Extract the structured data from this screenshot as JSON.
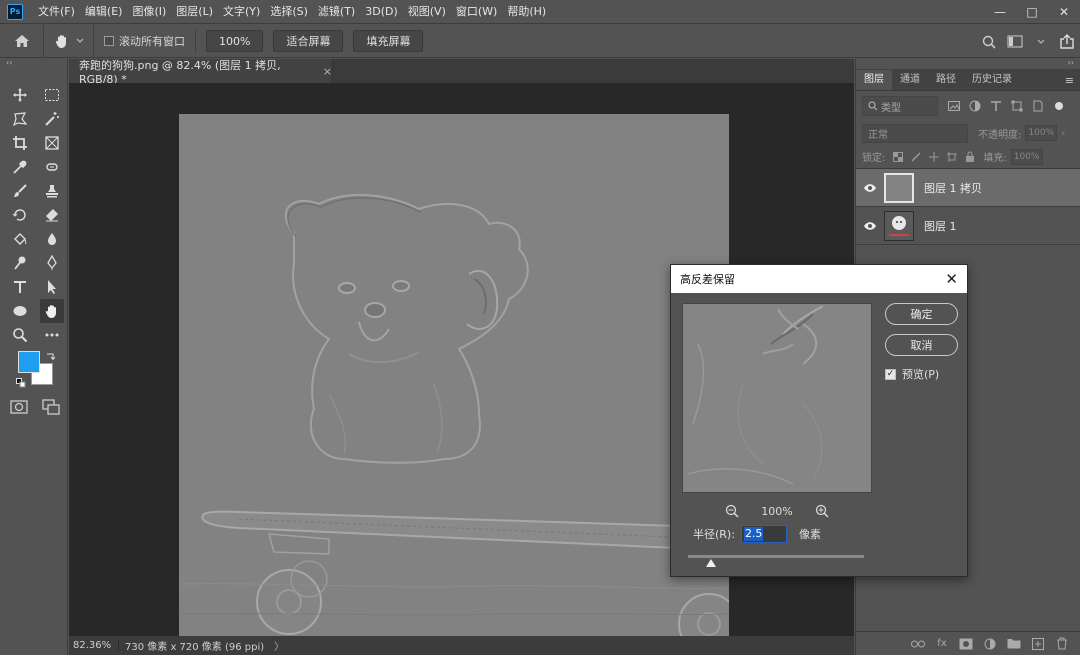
{
  "app": {
    "logo": "Ps"
  },
  "menubar": {
    "items": [
      "文件(F)",
      "编辑(E)",
      "图像(I)",
      "图层(L)",
      "文字(Y)",
      "选择(S)",
      "滤镜(T)",
      "3D(D)",
      "视图(V)",
      "窗口(W)",
      "帮助(H)"
    ],
    "window_controls": [
      "—",
      "□",
      "✕"
    ]
  },
  "options": {
    "scroll_all_label": "滚动所有窗口",
    "zoom_value": "100%",
    "fit_screen_label": "适合屏幕",
    "fill_screen_label": "填充屏幕"
  },
  "document": {
    "tab_title": "奔跑的狗狗.png @ 82.4% (图层 1 拷贝, RGB/8) *",
    "close_glyph": "×",
    "status_zoom": "82.36%",
    "status_info": "730 像素 x 720 像素 (96 ppi)",
    "status_arrow": "〉"
  },
  "toolbar": {
    "collapse_glyph": "‹‹",
    "tools": [
      "move-tool",
      "marquee-tool",
      "lasso-tool",
      "magic-wand-tool",
      "crop-tool",
      "frame-tool",
      "eyedropper-tool",
      "healing-tool",
      "brush-tool",
      "stamp-tool",
      "history-brush-tool",
      "eraser-tool",
      "paint-bucket-tool",
      "blur-tool",
      "dodge-tool",
      "pen-tool",
      "type-tool",
      "path-selection-tool",
      "ellipse-tool",
      "hand-tool",
      "zoom-tool",
      "more-tools"
    ],
    "active_tool": "hand-tool",
    "foreground_color": "#1f9ef0",
    "background_color": "#ffffff"
  },
  "panels": {
    "expand_glyph": "››",
    "tabs": [
      "图层",
      "通道",
      "路径",
      "历史记录"
    ],
    "active_tab": "图层",
    "filter_label": "类型",
    "blend_mode": "正常",
    "opacity_label": "不透明度:",
    "opacity_value": "100%",
    "lock_label": "锁定:",
    "fill_label": "填充:",
    "fill_value": "100%",
    "layers": [
      {
        "name": "图层 1 拷贝",
        "selected": true
      },
      {
        "name": "图层 1",
        "selected": false
      }
    ],
    "footer_fx": "fx"
  },
  "dialog": {
    "title": "高反差保留",
    "close_glyph": "✕",
    "ok_label": "确定",
    "cancel_label": "取消",
    "preview_label": "预览(P)",
    "preview_checked": true,
    "zoom_value": "100%",
    "radius_label": "半径(R):",
    "radius_value": "2.5",
    "radius_unit": "像素",
    "slider_position": 0.13
  },
  "colors": {
    "accent": "#31a8ff",
    "ui_bg": "#535353",
    "canvas_gray": "#828282"
  }
}
